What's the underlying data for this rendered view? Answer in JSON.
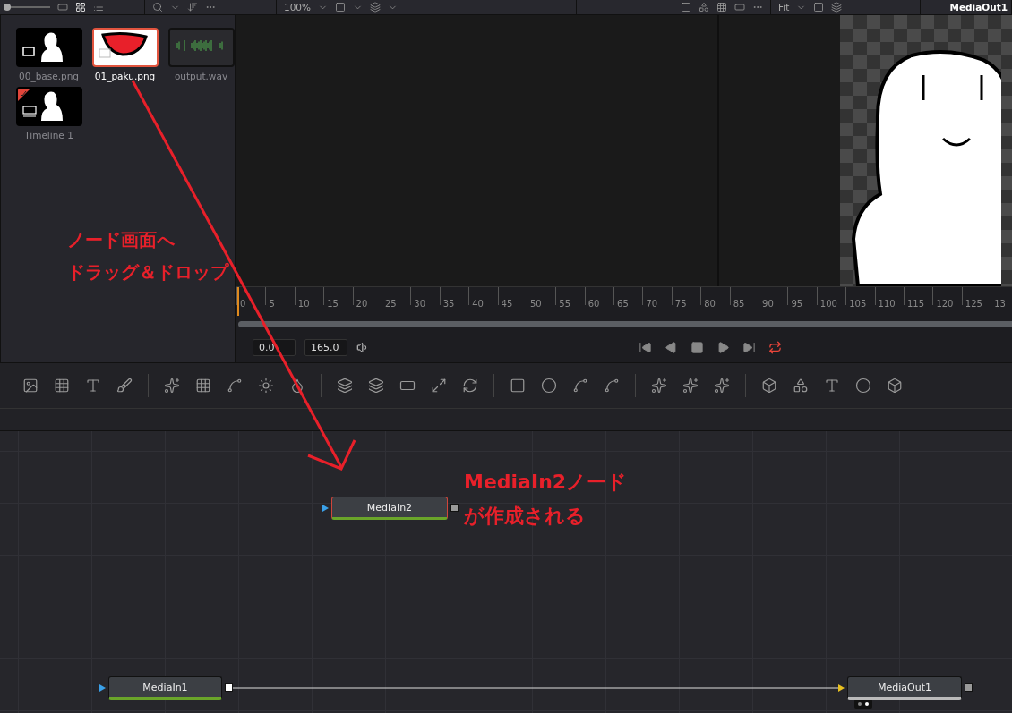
{
  "zoom_slider": {
    "level": 0
  },
  "toolbar": {
    "zoom": "100%",
    "fit": "Fit",
    "viewer_title": "MediaOut1"
  },
  "media_pool": [
    {
      "name": "00_base.png",
      "kind": "image",
      "selected": false
    },
    {
      "name": "01_paku.png",
      "kind": "mouth",
      "selected": true
    },
    {
      "name": "output.wav",
      "kind": "audio",
      "selected": false
    },
    {
      "name": "Timeline 1",
      "kind": "timeline",
      "selected": false
    }
  ],
  "ruler": {
    "ticks": [
      "0",
      "5",
      "10",
      "15",
      "20",
      "25",
      "30",
      "35",
      "40",
      "45",
      "50",
      "55",
      "60",
      "65",
      "70",
      "75",
      "80",
      "85",
      "90",
      "95",
      "100",
      "105",
      "110",
      "115",
      "120",
      "125",
      "13"
    ]
  },
  "transport": {
    "start": "0.0",
    "end": "165.0",
    "loop_on": true
  },
  "nodes": [
    {
      "name": "MediaIn2",
      "kind": "media_in",
      "selected": true
    },
    {
      "name": "MediaIn1",
      "kind": "media_in",
      "selected": false
    },
    {
      "name": "MediaOut1",
      "kind": "media_out",
      "selected": false
    }
  ],
  "annotations": [
    {
      "lines": [
        "ノード画面へ",
        "ドラッグ＆ドロップ"
      ]
    },
    {
      "lines": [
        "MediaIn2ノード",
        "が作成される"
      ]
    }
  ]
}
